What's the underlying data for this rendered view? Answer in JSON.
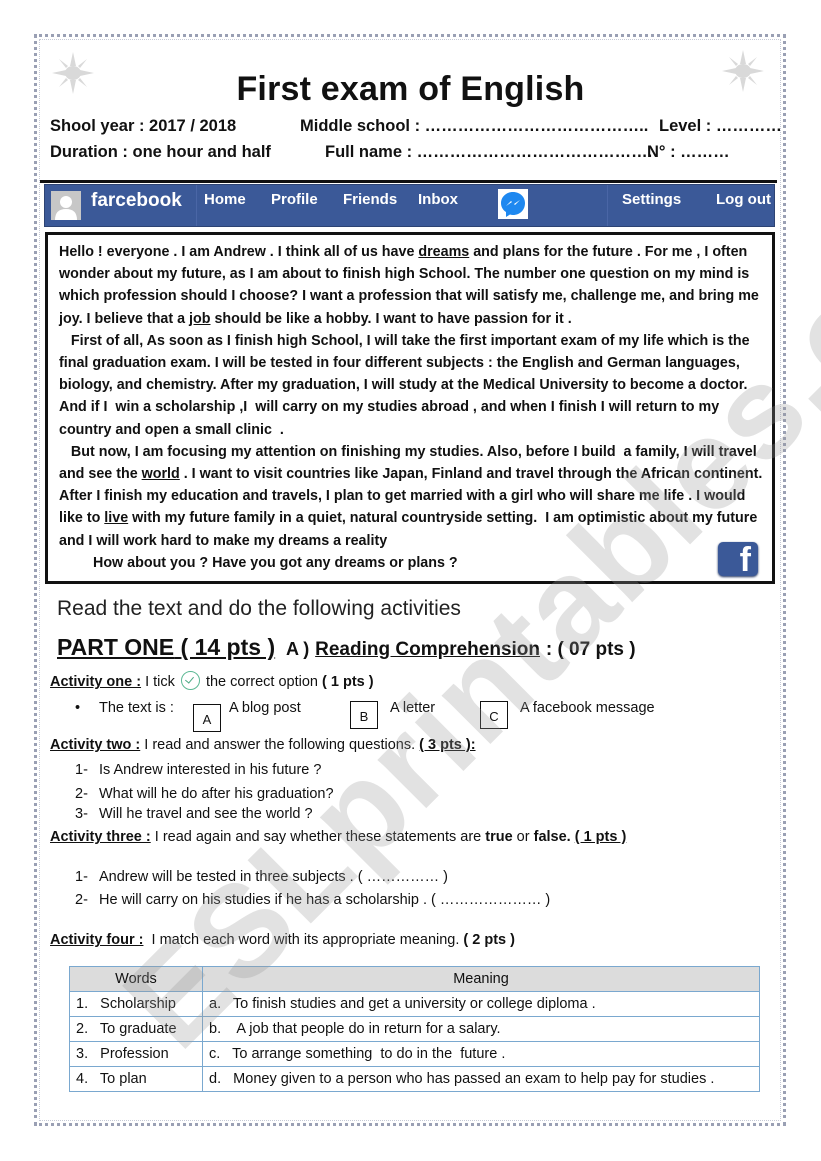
{
  "header": {
    "title": "First exam of English",
    "school_year": "Shool year : 2017 / 2018",
    "middle_school": "Middle school : …………………………………..",
    "level": "Level : …………",
    "duration": "Duration : one hour and half",
    "full_name": "Full name : …………………………………….",
    "number": "N° : ………"
  },
  "fb_bar": {
    "brand": "farcebook",
    "nav": [
      "Home",
      "Profile",
      "Friends",
      "Inbox"
    ],
    "right_nav": [
      "Settings",
      "Log out"
    ],
    "icons": [
      "avatar-placeholder",
      "messenger-icon"
    ],
    "color": "#3b5998"
  },
  "post": {
    "p1_a": " Hello ! everyone . I am Andrew . I think all of us have ",
    "p1_u1": "dreams",
    "p1_b": " and plans for the future . For me , I often wonder about my future, as I  am about to finish high School. The number one question on my mind is which profession should I choose?  I  want a profession that will satisfy me, challenge me, and bring me joy. I believe that a ",
    "p1_u2": "job",
    "p1_c": " should be like a hobby. I want to have passion for it .",
    "p2": "   First of all, As soon as I finish high School, I will take the first important exam of my life which is the final graduation exam. I will be tested in four different subjects : the English and German languages, biology, and chemistry. After my graduation, I will study at the Medical University to become a doctor. And if I  win a scholarship ,I  will carry on my studies abroad , and when I finish I will return to my country and open a small clinic  .",
    "p3_a": "   But now, I am focusing my attention on finishing my studies. Also, before I build  a family, I will travel and see the ",
    "p3_u1": "world",
    "p3_b": " . I want to visit countries like Japan, Finland and travel through the African continent. After I finish my education and travels, I plan to get married with a girl who will share me life . I would like to ",
    "p3_u2": "live",
    "p3_c": " with my future family in a quiet, natural countryside setting.  I am optimistic about my future and I will work hard to make my dreams a reality",
    "p4": "How about you ? Have you got any dreams or plans ?",
    "logo_letter": "f"
  },
  "instructions": "Read the text and do the following activities",
  "part": {
    "title": "PART ONE",
    "points": "( 14 pts )",
    "section_letter": "A )",
    "section_title": "Reading Comprehension",
    "section_points": ": ( 07 pts )"
  },
  "activity_one": {
    "label": "Activity one :",
    "text_a": " I tick ",
    "text_b": " the correct option ",
    "points": "( 1 pts )",
    "stem": "The text is  :",
    "options": [
      {
        "letter": "A",
        "text": "A blog post"
      },
      {
        "letter": "B",
        "text": "A letter"
      },
      {
        "letter": "C",
        "text": "A facebook message"
      }
    ]
  },
  "activity_two": {
    "label": "Activity two  :",
    "text": " I read and answer the following questions. ",
    "points": "( 3 pts ):",
    "questions": [
      {
        "n": "1-",
        "text": "Is Andrew interested in his future ?"
      },
      {
        "n": "2-",
        "text": "What will he do after his graduation?"
      },
      {
        "n": "3-",
        "text": "Will he travel and see the world ?"
      }
    ]
  },
  "activity_three": {
    "label": "Activity three :",
    "text_a": " I read again and say whether these statements  are ",
    "true_word": "true",
    "or": " or ",
    "false_word": "false.",
    "points": "( 1 pts )",
    "statements": [
      {
        "n": "1-",
        "text": "Andrew  will be tested in three subjects . ( …………… )"
      },
      {
        "n": "2-",
        "text": "He will carry on his studies if he has a scholarship . ( ………………… )"
      }
    ]
  },
  "activity_four": {
    "label": "Activity four :",
    "text": "  I match each word with its appropriate meaning. ",
    "points": "( 2 pts )",
    "headers": [
      "Words",
      "Meaning"
    ],
    "rows": [
      [
        "1.   Scholarship",
        "a.   To finish studies and get a university or college diploma ."
      ],
      [
        "2.   To graduate",
        "b.    A job that people do in return for a salary."
      ],
      [
        "3.   Profession",
        "c.   To arrange something  to do in the  future ."
      ],
      [
        "4.   To plan",
        "d.   Money given to a person who has passed an exam to help pay for studies ."
      ]
    ]
  },
  "watermark": "ESLprintables.com"
}
